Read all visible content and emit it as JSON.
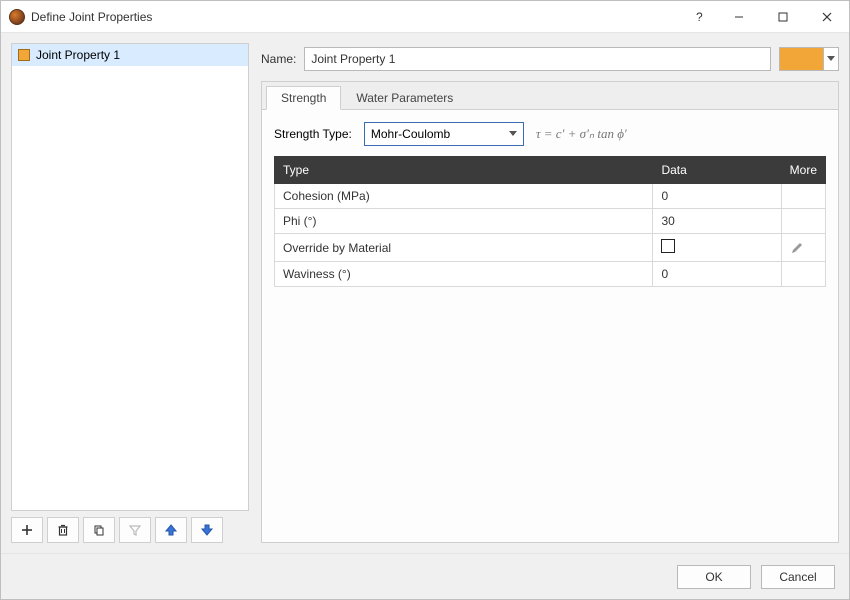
{
  "window": {
    "title": "Define Joint Properties"
  },
  "sidebar": {
    "items": [
      {
        "label": "Joint Property 1",
        "selected": true
      }
    ]
  },
  "name_row": {
    "label": "Name:",
    "value": "Joint Property 1",
    "color": "#f3a638"
  },
  "tabs": {
    "strength": "Strength",
    "water": "Water Parameters"
  },
  "strength": {
    "type_label": "Strength Type:",
    "type_value": "Mohr-Coulomb",
    "formula": "τ = c′ + σ′ₙ tan ϕ′",
    "columns": {
      "type": "Type",
      "data": "Data",
      "more": "More"
    },
    "rows": [
      {
        "type": "Cohesion (MPa)",
        "data": "0",
        "more": ""
      },
      {
        "type": "Phi (°)",
        "data": "30",
        "more": ""
      },
      {
        "type": "Override by Material",
        "data": "checkbox",
        "more": "edit"
      },
      {
        "type": "Waviness (°)",
        "data": "0",
        "more": ""
      }
    ]
  },
  "footer": {
    "ok": "OK",
    "cancel": "Cancel"
  }
}
